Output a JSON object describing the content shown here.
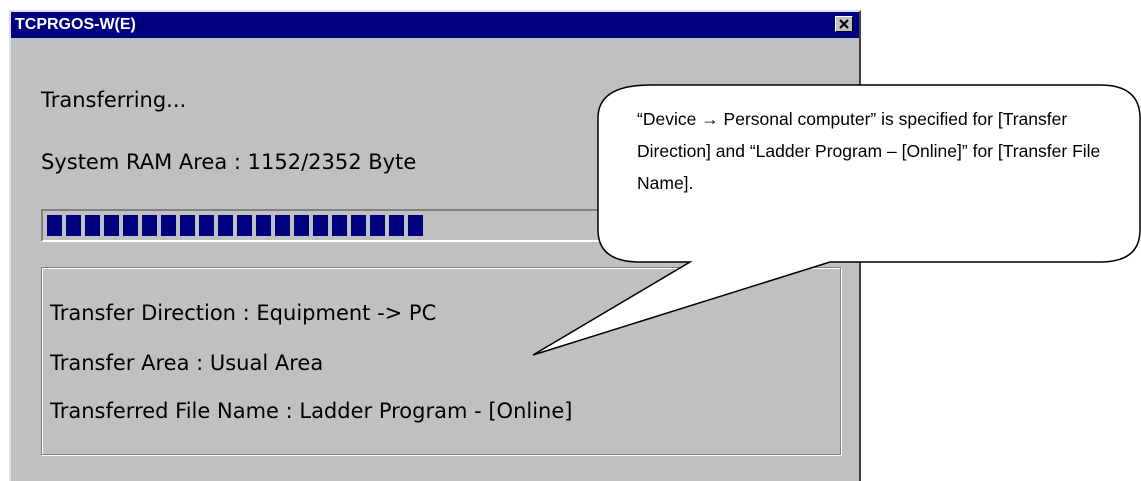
{
  "window": {
    "title": "TCPRGOS-W(E)"
  },
  "status": "Transferring...",
  "area_status": "System RAM Area : 1152/2352 Byte",
  "progress": {
    "fraction": 0.49,
    "color": "#000080"
  },
  "info": {
    "direction": "Transfer Direction : Equipment -> PC",
    "area": "Transfer Area : Usual Area",
    "file_name": "Transferred File Name : Ladder Program - [Online]"
  },
  "callout": {
    "text": "“Device → Personal computer” is specified for [Transfer Direction] and “Ladder Program – [Online]” for [Transfer File Name]."
  },
  "icons": {
    "close": "close-icon"
  }
}
